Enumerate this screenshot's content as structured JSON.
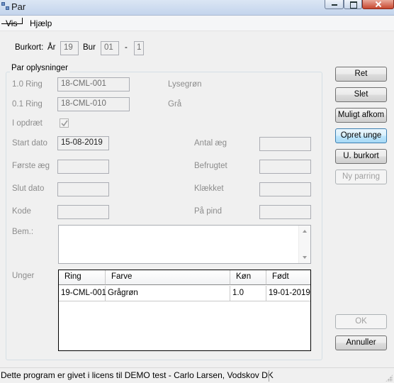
{
  "window": {
    "title": "Par"
  },
  "menu": {
    "vis": "Vis",
    "hjaelp": "Hjælp"
  },
  "burkort": {
    "label": "Burkort:",
    "year_label": "År",
    "year_value": "19",
    "cage_label": "Bur",
    "cage_value": "01",
    "separator": "-",
    "number_value": "1"
  },
  "group": {
    "title": "Par oplysninger",
    "ring10_label": "1.0 Ring",
    "ring10_value": "18-CML-001",
    "ring10_color": "Lysegrøn",
    "ring01_label": "0.1 Ring",
    "ring01_value": "18-CML-010",
    "ring01_color": "Grå",
    "in_breeding_label": "I opdræt",
    "in_breeding_checked": true,
    "start_date_label": "Start dato",
    "start_date_value": "15-08-2019",
    "first_egg_label": "Første æg",
    "first_egg_value": "",
    "end_date_label": "Slut dato",
    "end_date_value": "",
    "code_label": "Kode",
    "code_value": "",
    "egg_count_label": "Antal æg",
    "egg_count_value": "",
    "fertilized_label": "Befrugtet",
    "fertilized_value": "",
    "hatched_label": "Klækket",
    "hatched_value": "",
    "on_perch_label": "På pind",
    "on_perch_value": "",
    "remarks_label": "Bem.:",
    "remarks_value": "",
    "young_label": "Unger"
  },
  "young_table": {
    "columns": [
      "Ring",
      "Farve",
      "Køn",
      "Født"
    ],
    "rows": [
      [
        "19-CML-001",
        "Grågrøn",
        "1.0",
        "19-01-2019"
      ]
    ]
  },
  "buttons": {
    "ret": "Ret",
    "slet": "Slet",
    "muligt_afkom": "Muligt afkom",
    "opret_unge": "Opret unge",
    "u_burkort": "U. burkort",
    "ny_parring": "Ny parring",
    "ok": "OK",
    "annuller": "Annuller"
  },
  "status": {
    "text": "Dette program er givet i licens til DEMO test - Carlo Larsen, Vodskov DK"
  }
}
